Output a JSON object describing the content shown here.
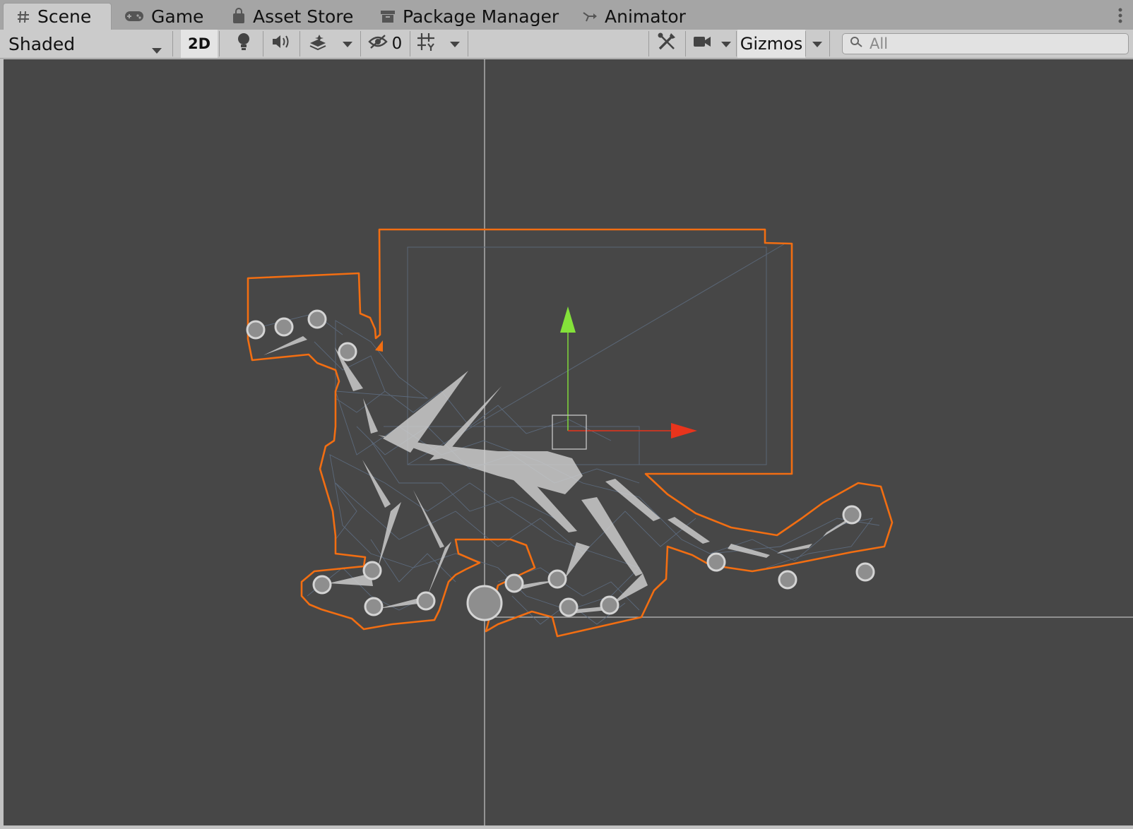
{
  "tabs": [
    {
      "label": "Scene",
      "icon": "grid-hash-icon",
      "active": true
    },
    {
      "label": "Game",
      "icon": "gamepad-icon",
      "active": false
    },
    {
      "label": "Asset Store",
      "icon": "shopping-bag-icon",
      "active": false
    },
    {
      "label": "Package Manager",
      "icon": "package-box-icon",
      "active": false
    },
    {
      "label": "Animator",
      "icon": "animator-branch-icon",
      "active": false
    }
  ],
  "toolbar": {
    "shading_mode": "Shaded",
    "mode_2d_label": "2D",
    "mode_2d_active": true,
    "hidden_objects_count": "0",
    "gizmos_label": "Gizmos",
    "search_placeholder": "All"
  },
  "colors": {
    "selection_outline": "#f26e12",
    "y_axis_handle": "#84e23a",
    "x_axis_handle": "#e8341c",
    "viewport_bg": "#474747"
  }
}
